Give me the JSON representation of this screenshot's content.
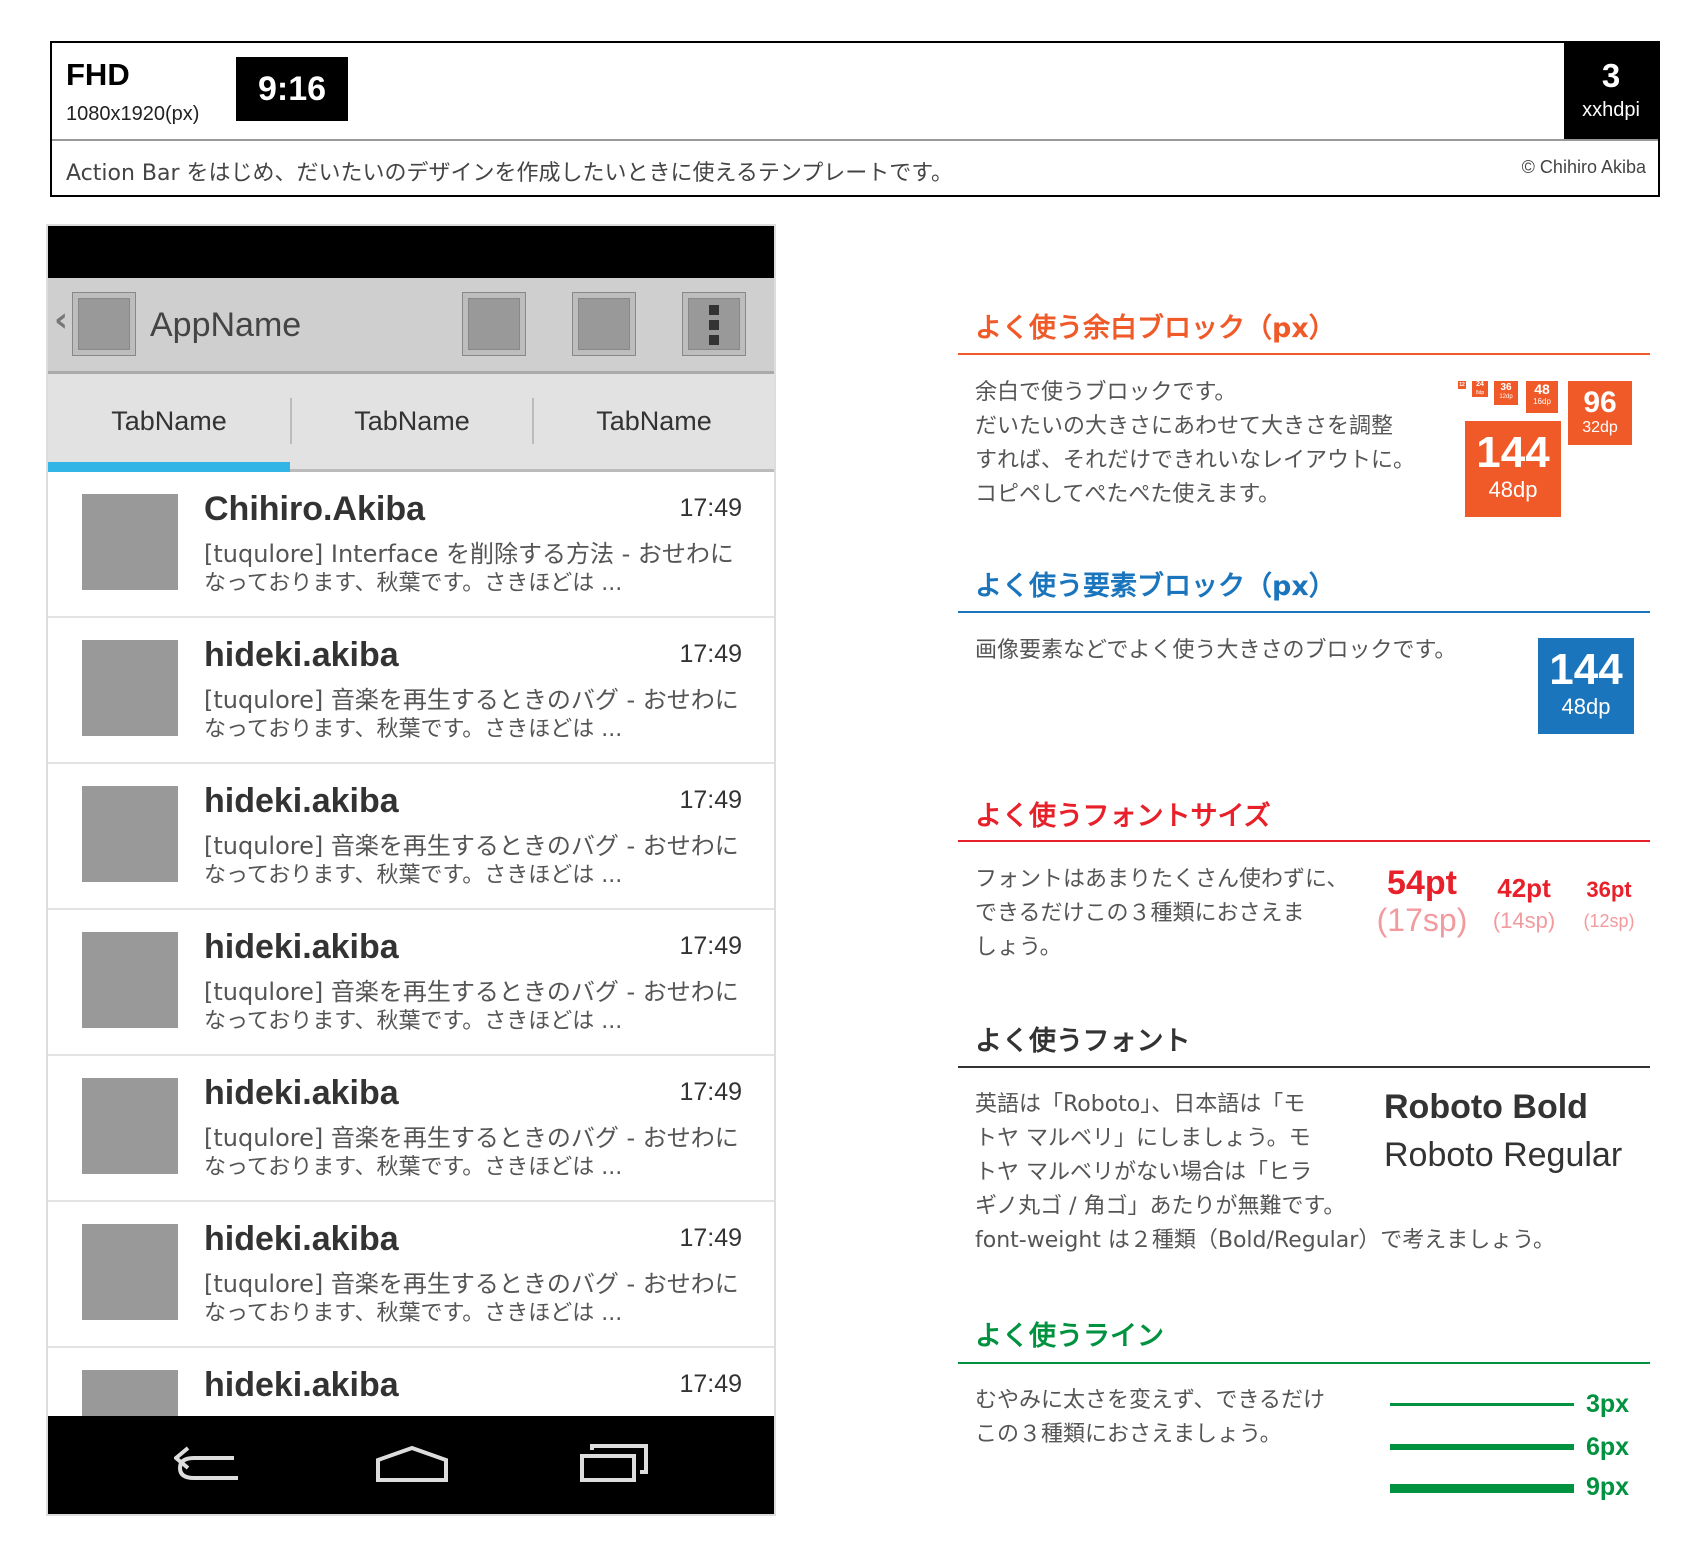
{
  "header": {
    "resolution_name": "FHD",
    "resolution_px": "1080x1920(px)",
    "aspect_ratio": "9:16",
    "density_multiplier": "3",
    "density_name": "xxhdpi",
    "description": "Action Bar をはじめ、だいたいのデザインを作成したいときに使えるテンプレートです。",
    "copyright": "© Chihiro Akiba"
  },
  "phone": {
    "action_bar": {
      "back_glyph": "‹",
      "app_name": "AppName"
    },
    "tabs": [
      {
        "label": "TabName"
      },
      {
        "label": "TabName"
      },
      {
        "label": "TabName"
      }
    ],
    "selected_tab_index": 0,
    "accent_color": "#33b5e5",
    "messages": [
      {
        "sender": "Chihiro.Akiba",
        "time": "17:49",
        "line1": "[tuqulore] Interface を削除する方法 - おせわに",
        "line2": "なっております、秋葉です。さきほどは ..."
      },
      {
        "sender": "hideki.akiba",
        "time": "17:49",
        "line1": "[tuqulore] 音楽を再生するときのバグ - おせわに",
        "line2": "なっております、秋葉です。さきほどは ..."
      },
      {
        "sender": "hideki.akiba",
        "time": "17:49",
        "line1": "[tuqulore] 音楽を再生するときのバグ - おせわに",
        "line2": "なっております、秋葉です。さきほどは ..."
      },
      {
        "sender": "hideki.akiba",
        "time": "17:49",
        "line1": "[tuqulore] 音楽を再生するときのバグ - おせわに",
        "line2": "なっております、秋葉です。さきほどは ..."
      },
      {
        "sender": "hideki.akiba",
        "time": "17:49",
        "line1": "[tuqulore] 音楽を再生するときのバグ - おせわに",
        "line2": "なっております、秋葉です。さきほどは ..."
      },
      {
        "sender": "hideki.akiba",
        "time": "17:49",
        "line1": "[tuqulore] 音楽を再生するときのバグ - おせわに",
        "line2": "なっております、秋葉です。さきほどは ..."
      },
      {
        "sender": "hideki.akiba",
        "time": "17:49",
        "line1": "",
        "line2": ""
      }
    ],
    "nav_icons": [
      "back-icon",
      "home-icon",
      "recent-apps-icon"
    ]
  },
  "guide": {
    "spacing": {
      "title": "よく使う余白ブロック（px）",
      "color": "#f05a28",
      "body": [
        "余白で使うブロックです。",
        "だいたいの大きさにあわせて大きさを調整",
        "すれば、それだけできれいなレイアウトに。",
        "コピペしてぺたぺた使えます。"
      ],
      "blocks": [
        {
          "px": "12",
          "dp": "4dp"
        },
        {
          "px": "24",
          "dp": "8dp"
        },
        {
          "px": "36",
          "dp": "12dp"
        },
        {
          "px": "48",
          "dp": "16dp"
        },
        {
          "px": "96",
          "dp": "32dp"
        },
        {
          "px": "144",
          "dp": "48dp"
        }
      ]
    },
    "element": {
      "title": "よく使う要素ブロック（px）",
      "color": "#1b75bc",
      "body": [
        "画像要素などでよく使う大きさのブロックです。"
      ],
      "block": {
        "px": "144",
        "dp": "48dp"
      }
    },
    "font_size": {
      "title": "よく使うフォントサイズ",
      "color": "#e8202a",
      "sub_color": "#f29a9e",
      "body": [
        "フォントはあまりたくさん使わずに、",
        "できるだけこの３種類におさえま",
        "しょう。"
      ],
      "sizes": [
        {
          "pt": "54pt",
          "sp": "(17sp)"
        },
        {
          "pt": "42pt",
          "sp": "(14sp)"
        },
        {
          "pt": "36pt",
          "sp": "(12sp)"
        }
      ]
    },
    "fonts": {
      "title": "よく使うフォント",
      "color": "#333333",
      "body": [
        "英語は「Roboto」、日本語は「モ",
        "トヤ マルベリ」にしましょう。モ",
        "トヤ マルベリがない場合は「ヒラ",
        "ギノ丸ゴ / 角ゴ」あたりが無難です。",
        "font-weight は２種類（Bold/Regular）で考えましょう。"
      ],
      "bold_sample": "Roboto Bold",
      "regular_sample": "Roboto Regular"
    },
    "lines": {
      "title": "よく使うライン",
      "color": "#00923f",
      "body": [
        "むやみに太さを変えず、できるだけ",
        "この３種類におさえましょう。"
      ],
      "widths": [
        "3px",
        "6px",
        "9px"
      ]
    }
  }
}
